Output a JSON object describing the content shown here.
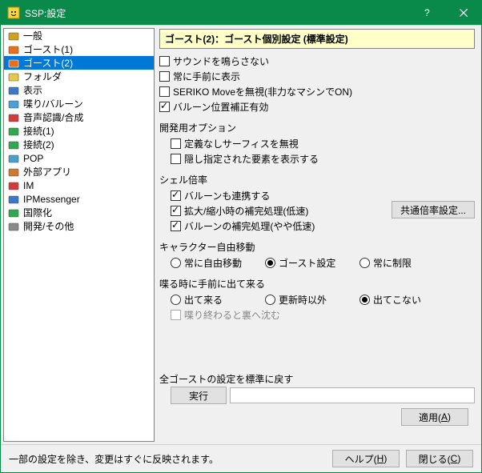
{
  "window": {
    "title": "SSP:設定"
  },
  "sidebar": {
    "items": [
      {
        "label": "一般",
        "color": "#d4a017"
      },
      {
        "label": "ゴースト(1)",
        "color": "#e96f1c"
      },
      {
        "label": "ゴースト(2)",
        "color": "#e96f1c",
        "selected": true
      },
      {
        "label": "フォルダ",
        "color": "#e6c84b"
      },
      {
        "label": "表示",
        "color": "#3a78c9"
      },
      {
        "label": "喋り/バルーン",
        "color": "#49a0d8"
      },
      {
        "label": "音声認識/合成",
        "color": "#d23b3b"
      },
      {
        "label": "接続(1)",
        "color": "#2fa84f"
      },
      {
        "label": "接続(2)",
        "color": "#2fa84f"
      },
      {
        "label": "POP",
        "color": "#47a0c9"
      },
      {
        "label": "外部アプリ",
        "color": "#d17a2b"
      },
      {
        "label": "IM",
        "color": "#d23b3b"
      },
      {
        "label": "IPMessenger",
        "color": "#3a78c9"
      },
      {
        "label": "国際化",
        "color": "#2fa84f"
      },
      {
        "label": "開発/その他",
        "color": "#8a8a8a"
      }
    ]
  },
  "content": {
    "header": "ゴースト(2)：ゴースト個別設定 (標準設定)",
    "chk_sound": "サウンドを鳴らさない",
    "chk_front": "常に手前に表示",
    "chk_seriko": "SERIKO Moveを無視(非力なマシンでON)",
    "chk_balloon_pos": "バルーン位置補正有効",
    "dev_title": "開発用オプション",
    "chk_nodef": "定義なしサーフィスを無視",
    "chk_hidden": "隠し指定された要素を表示する",
    "shell_title": "シェル倍率",
    "chk_balloon_link": "バルーンも連携する",
    "chk_scale_comp": "拡大/縮小時の補完処理(低速)",
    "chk_balloon_comp": "バルーンの補完処理(やや低速)",
    "btn_common_scale": "共通倍率設定...",
    "char_title": "キャラクター自由移動",
    "char_r1": "常に自由移動",
    "char_r2": "ゴースト設定",
    "char_r3": "常に制限",
    "talk_title": "喋る時に手前に出て来る",
    "talk_r1": "出て来る",
    "talk_r2": "更新時以外",
    "talk_r3": "出てこない",
    "chk_sink": "喋り終わると裏へ沈む",
    "reset_title": "全ゴーストの設定を標準に戻す",
    "btn_exec": "実行"
  },
  "buttons": {
    "apply": "適用(A)",
    "help": "ヘルプ(H)",
    "close": "閉じる(C)"
  },
  "footer": {
    "note": "一部の設定を除き、変更はすぐに反映されます。"
  }
}
